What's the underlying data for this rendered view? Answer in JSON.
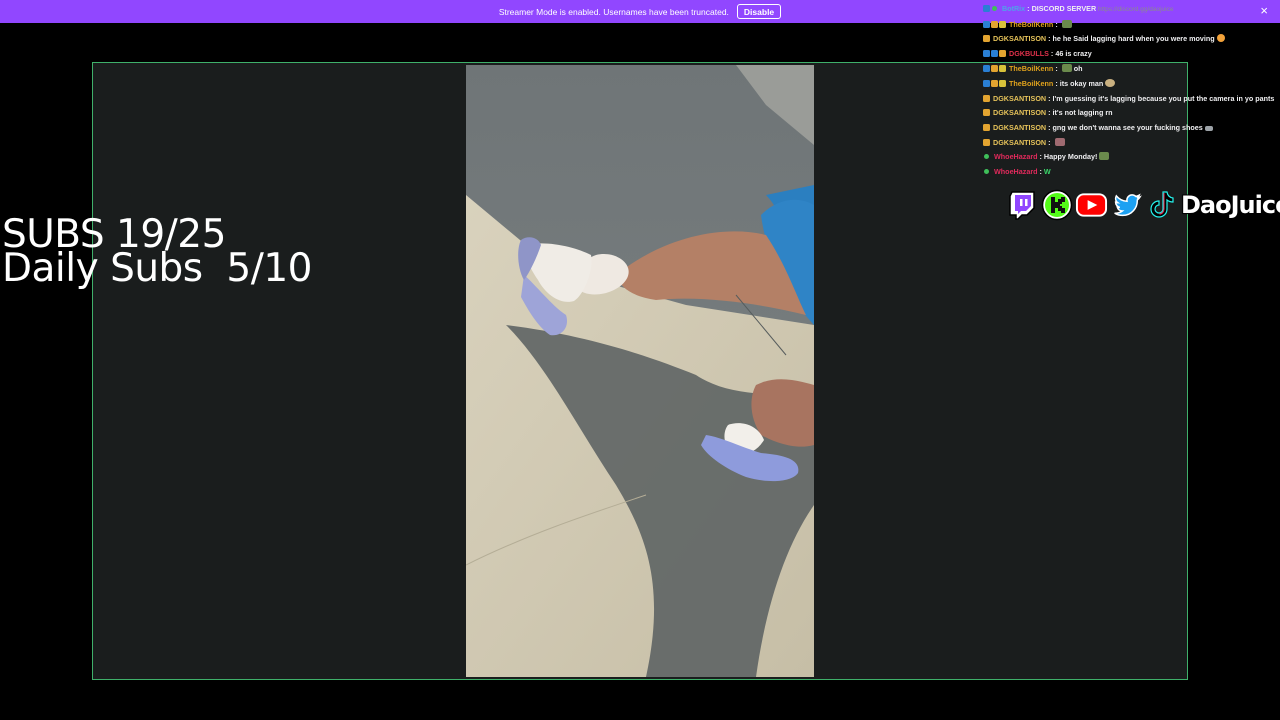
{
  "banner": {
    "message": "Streamer Mode is enabled. Usernames have been truncated.",
    "disable_label": "Disable",
    "close_glyph": "×",
    "color": "#9147ff"
  },
  "overlay": {
    "subs": "SUBS 19/25",
    "daily_subs": "Daily Subs  5/10"
  },
  "chat": {
    "messages": [
      {
        "user": "BotRix",
        "user_color": "#4fa3e8",
        "badges": [
          "blue",
          "green-dot"
        ],
        "text": "DISCORD SERVER",
        "link": "https://discord.gg/daojuice"
      },
      {
        "user": "TheBoilKenn",
        "user_color": "#e0a21c",
        "badges": [
          "blue",
          "orange",
          "yellow"
        ],
        "text": "",
        "emote": "tree"
      },
      {
        "user": "DGKSANTISON",
        "user_color": "#e6c35a",
        "badges": [
          "orange"
        ],
        "text": "he he Said lagging hard when you were moving",
        "emote": "smile"
      },
      {
        "user": "DGKBULLS",
        "user_color": "#e0314b",
        "badges": [
          "blue",
          "blue",
          "orange"
        ],
        "text": "46 is crazy"
      },
      {
        "user": "TheBoilKenn",
        "user_color": "#e0a21c",
        "badges": [
          "blue",
          "orange",
          "yellow"
        ],
        "text": "oh",
        "emote_before": "tree"
      },
      {
        "user": "TheBoilKenn",
        "user_color": "#e0a21c",
        "badges": [
          "blue",
          "orange",
          "yellow"
        ],
        "text": "its okay man",
        "emote": "face"
      },
      {
        "user": "DGKSANTISON",
        "user_color": "#e6c35a",
        "badges": [
          "orange"
        ],
        "text": "I'm guessing it's lagging because you put the camera in yo pants",
        "wrap": true
      },
      {
        "user": "DGKSANTISON",
        "user_color": "#e6c35a",
        "badges": [
          "orange"
        ],
        "text": "it's not lagging rn"
      },
      {
        "user": "DGKSANTISON",
        "user_color": "#e6c35a",
        "badges": [
          "orange"
        ],
        "text": "gng we don't wanna see your fucking shoes",
        "emote": "knife"
      },
      {
        "user": "DGKSANTISON",
        "user_color": "#e6c35a",
        "badges": [
          "orange"
        ],
        "text": "",
        "emote": "pic"
      },
      {
        "user": "WhoeHazard",
        "user_color": "#e02a5b",
        "badges": [
          "green-dot"
        ],
        "text": "Happy Monday!",
        "emote": "tree"
      },
      {
        "user": "WhoeHazard",
        "user_color": "#e02a5b",
        "badges": [
          "green-dot"
        ],
        "text": "W",
        "w": true
      }
    ]
  },
  "socials": {
    "icons": [
      "twitch-icon",
      "kick-icon",
      "youtube-icon",
      "twitter-icon",
      "tiktok-icon"
    ],
    "brand": "DaoJuice"
  },
  "colors": {
    "frame_border": "#3fb06a",
    "frame_bg": "#1a1d1d",
    "twitch": "#9146ff",
    "kick": "#53fc18",
    "youtube": "#ff0000",
    "twitter": "#1da1f2"
  }
}
